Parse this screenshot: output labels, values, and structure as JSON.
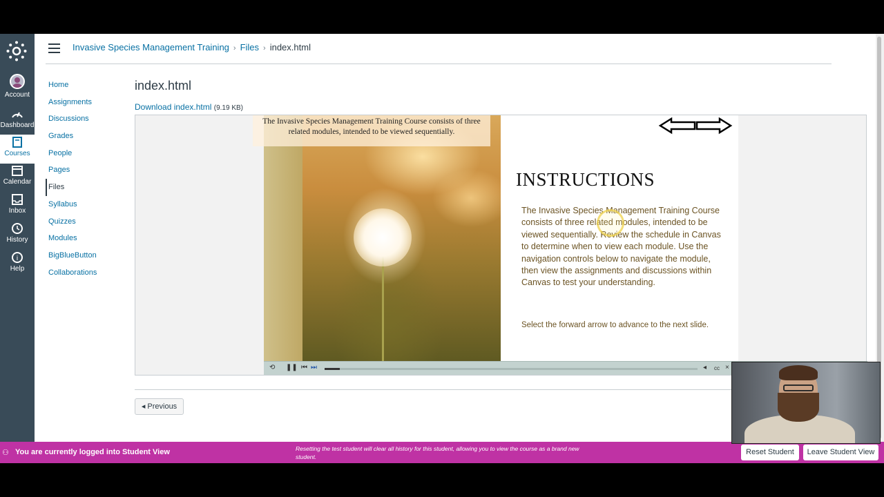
{
  "global_nav": {
    "items": [
      {
        "label": "Account",
        "icon": "account-avatar"
      },
      {
        "label": "Dashboard",
        "icon": "dashboard-icon"
      },
      {
        "label": "Courses",
        "icon": "courses-icon",
        "active": true
      },
      {
        "label": "Calendar",
        "icon": "calendar-icon"
      },
      {
        "label": "Inbox",
        "icon": "inbox-icon"
      },
      {
        "label": "History",
        "icon": "history-icon"
      },
      {
        "label": "Help",
        "icon": "help-icon"
      }
    ]
  },
  "breadcrumbs": {
    "course": "Invasive Species Management Training",
    "section": "Files",
    "current": "index.html"
  },
  "course_nav": {
    "items": [
      "Home",
      "Assignments",
      "Discussions",
      "Grades",
      "People",
      "Pages",
      "Files",
      "Syllabus",
      "Quizzes",
      "Modules",
      "BigBlueButton",
      "Collaborations"
    ],
    "active": "Files"
  },
  "page": {
    "title": "index.html",
    "download_label": "Download index.html",
    "file_size": "(9.19 KB)"
  },
  "slide": {
    "caption": "The Invasive Species Management Training Course consists of three related modules, intended to be viewed sequentially.",
    "heading": "INSTRUCTIONS",
    "body": "The Invasive Species Management Training Course consists of three related modules, intended to be viewed sequentially. Review the schedule in Canvas to determine when to view each module. Use the navigation controls below to navigate the module, then view the assignments and discussions within Canvas to test your understanding.",
    "next_hint": "Select the forward arrow to advance to the next slide."
  },
  "footer": {
    "previous_label": "◂ Previous"
  },
  "student_view": {
    "message": "You are currently logged into Student View",
    "note": "Resetting the test student will clear all history for this student, allowing you to view the course as a brand new student.",
    "reset_label": "Reset Student",
    "leave_label": "Leave Student View"
  },
  "colors": {
    "nav_bg": "#394B58",
    "link": "#0770A3",
    "student_bar": "#BF32A4"
  }
}
